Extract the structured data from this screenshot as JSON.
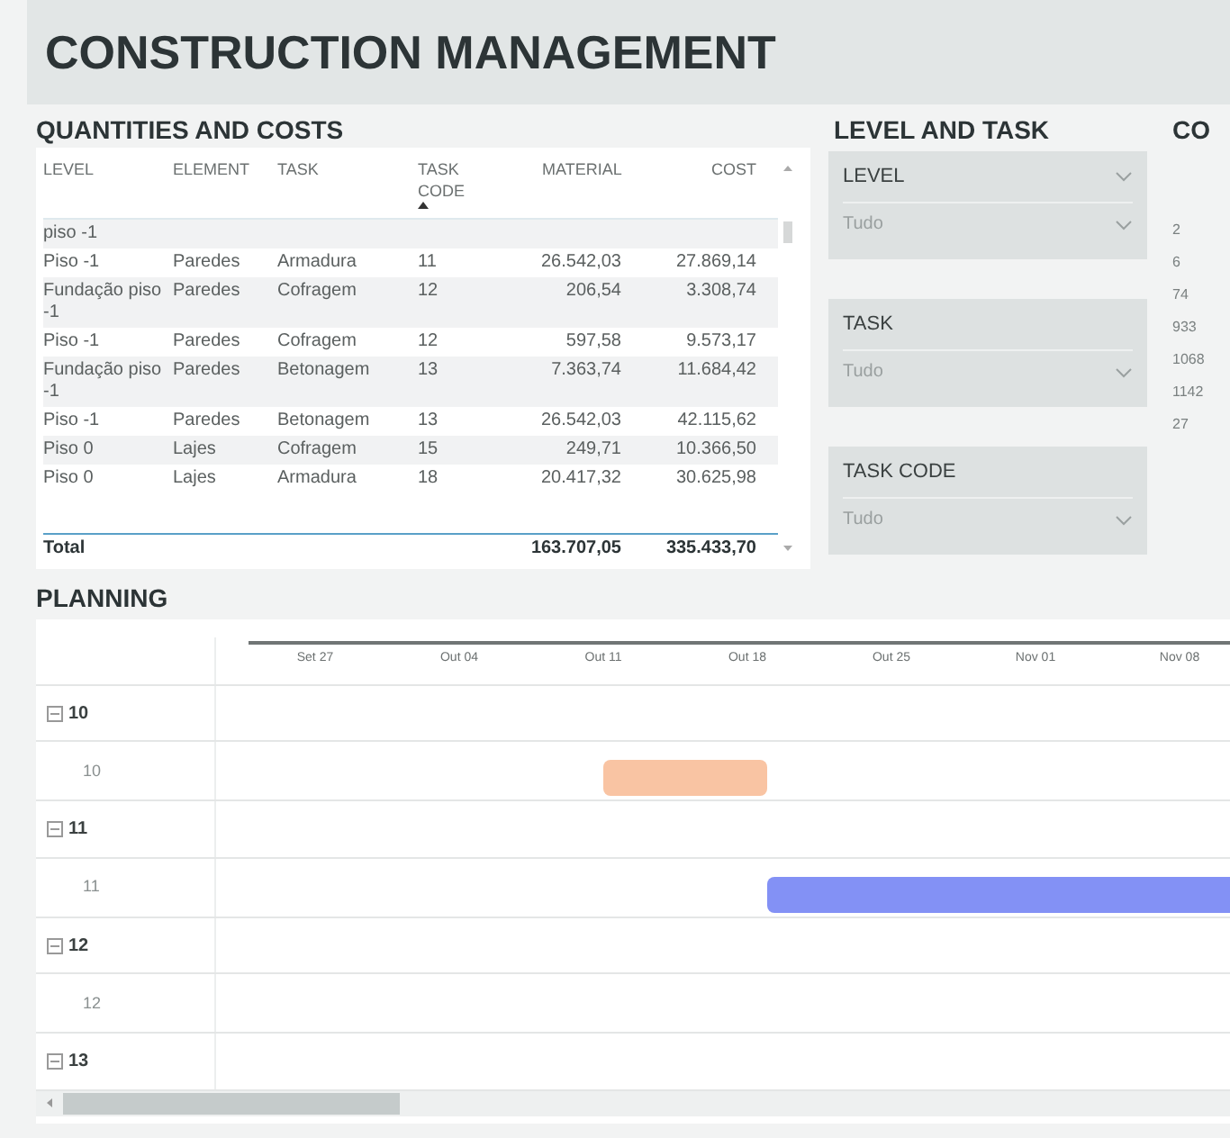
{
  "title": "CONSTRUCTION MANAGEMENT",
  "quantities": {
    "title": "QUANTITIES AND COSTS",
    "columns": [
      {
        "label": "LEVEL",
        "kind": "text",
        "sorted": false
      },
      {
        "label": "ELEMENT",
        "kind": "text",
        "sorted": false
      },
      {
        "label": "TASK",
        "kind": "text",
        "sorted": false
      },
      {
        "label": "TASK CODE",
        "kind": "text",
        "sorted": true
      },
      {
        "label": "MATERIAL",
        "kind": "number",
        "sorted": false
      },
      {
        "label": "COST",
        "kind": "number",
        "sorted": false
      }
    ],
    "rows": [
      {
        "level": "piso -1"
      },
      {
        "level": "Piso -1",
        "element": "Paredes",
        "task": "Armadura",
        "task_code": "11",
        "material": "26.542,03",
        "cost": "27.869,14"
      },
      {
        "level": "Fundação piso -1",
        "element": "Paredes",
        "task": "Cofragem",
        "task_code": "12",
        "material": "206,54",
        "cost": "3.308,74"
      },
      {
        "level": "Piso -1",
        "element": "Paredes",
        "task": "Cofragem",
        "task_code": "12",
        "material": "597,58",
        "cost": "9.573,17"
      },
      {
        "level": "Fundação piso -1",
        "element": "Paredes",
        "task": "Betonagem",
        "task_code": "13",
        "material": "7.363,74",
        "cost": "11.684,42"
      },
      {
        "level": "Piso -1",
        "element": "Paredes",
        "task": "Betonagem",
        "task_code": "13",
        "material": "26.542,03",
        "cost": "42.115,62"
      },
      {
        "level": "Piso 0",
        "element": "Lajes",
        "task": "Cofragem",
        "task_code": "15",
        "material": "249,71",
        "cost": "10.366,50"
      },
      {
        "level": "Piso 0",
        "element": "Lajes",
        "task": "Armadura",
        "task_code": "18",
        "material": "20.417,32",
        "cost": "30.625,98"
      }
    ],
    "total": {
      "level": "Total",
      "material": "163.707,05",
      "cost": "335.433,70"
    }
  },
  "filters": {
    "title": "LEVEL AND TASK",
    "slicers": [
      {
        "label": "LEVEL",
        "value": "Tudo",
        "header_caret": true
      },
      {
        "label": "TASK",
        "value": "Tudo",
        "header_caret": false
      },
      {
        "label": "TASK CODE",
        "value": "Tudo",
        "header_caret": false
      }
    ]
  },
  "cost_panel": {
    "title": "CO",
    "values": [
      "2",
      "6",
      "74",
      "933",
      "1068",
      "1142",
      "27"
    ]
  },
  "planning": {
    "title": "PLANNING",
    "ticks": [
      "Set 27",
      "Out 04",
      "Out 11",
      "Out 18",
      "Out 25",
      "Nov 01",
      "Nov 08"
    ],
    "groups": [
      {
        "label": "10",
        "expanded": true,
        "children": [
          {
            "label": "10",
            "color": "#f9c4a3"
          }
        ]
      },
      {
        "label": "11",
        "expanded": true,
        "children": [
          {
            "label": "11",
            "color": "#8391f5"
          }
        ]
      },
      {
        "label": "12",
        "expanded": true,
        "children": [
          {
            "label": "12"
          }
        ]
      },
      {
        "label": "13",
        "expanded": true
      }
    ]
  }
}
